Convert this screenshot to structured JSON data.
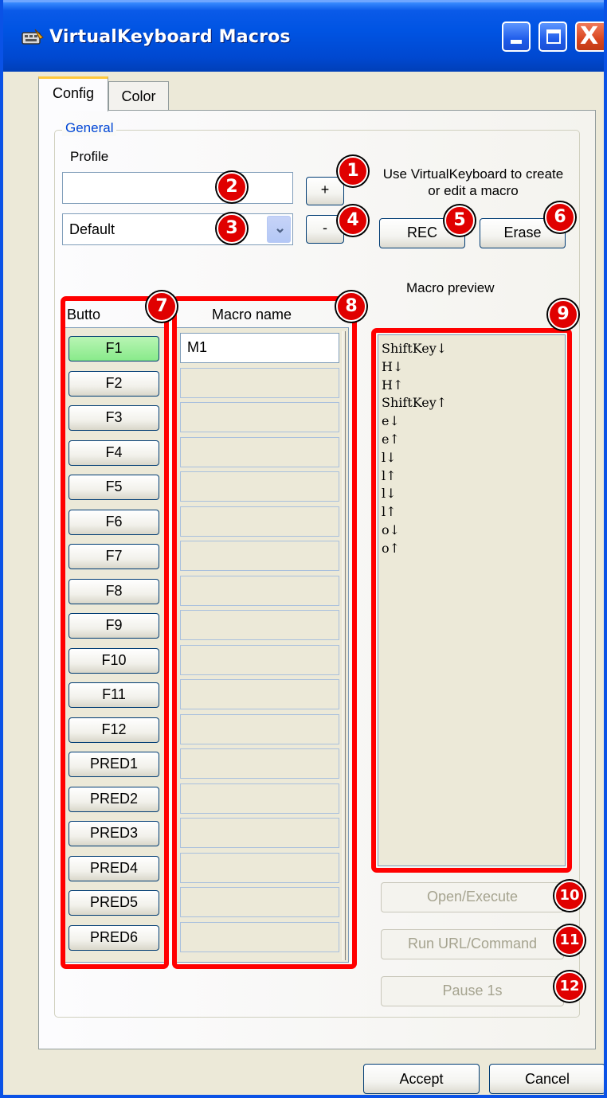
{
  "window": {
    "title": "VirtualKeyboard Macros",
    "close_glyph": "X",
    "icon": "app-icon"
  },
  "tabs": [
    {
      "label": "Config"
    },
    {
      "label": "Color"
    }
  ],
  "general": {
    "legend": "General",
    "profile_label": "Profile",
    "profile_name_value": "",
    "profile_select_value": "Default",
    "add_label": "+",
    "remove_label": "-",
    "hint": "Use VirtualKeyboard to create or edit a macro",
    "rec_label": "REC",
    "erase_label": "Erase",
    "preview_title": "Macro preview"
  },
  "table": {
    "button_header": "Butto",
    "name_header": "Macro name",
    "buttons": [
      "F1",
      "F2",
      "F3",
      "F4",
      "F5",
      "F6",
      "F7",
      "F8",
      "F9",
      "F10",
      "F11",
      "F12",
      "PRED1",
      "PRED2",
      "PRED3",
      "PRED4",
      "PRED5",
      "PRED6"
    ],
    "active_button": "F1",
    "macro_names": [
      "M1",
      "",
      "",
      "",
      "",
      "",
      "",
      "",
      "",
      "",
      "",
      "",
      "",
      "",
      "",
      "",
      "",
      ""
    ]
  },
  "preview_lines": [
    "ShiftKey↓",
    "H↓",
    "H↑",
    "ShiftKey↑",
    "e↓",
    "e↑",
    "l↓",
    "l↑",
    "l↓",
    "l↑",
    "o↓",
    "o↑"
  ],
  "actions": {
    "open_execute": "Open/Execute",
    "run_url": "Run URL/Command",
    "pause": "Pause 1s"
  },
  "footer": {
    "accept": "Accept",
    "cancel": "Cancel"
  },
  "badges": [
    "1",
    "2",
    "3",
    "4",
    "5",
    "6",
    "7",
    "8",
    "9",
    "10",
    "11",
    "12"
  ],
  "colors": {
    "titlebar": "#0054e3",
    "highlight": "#ff0000",
    "active_key": "#88ea8a",
    "link_blue": "#0046d5"
  }
}
